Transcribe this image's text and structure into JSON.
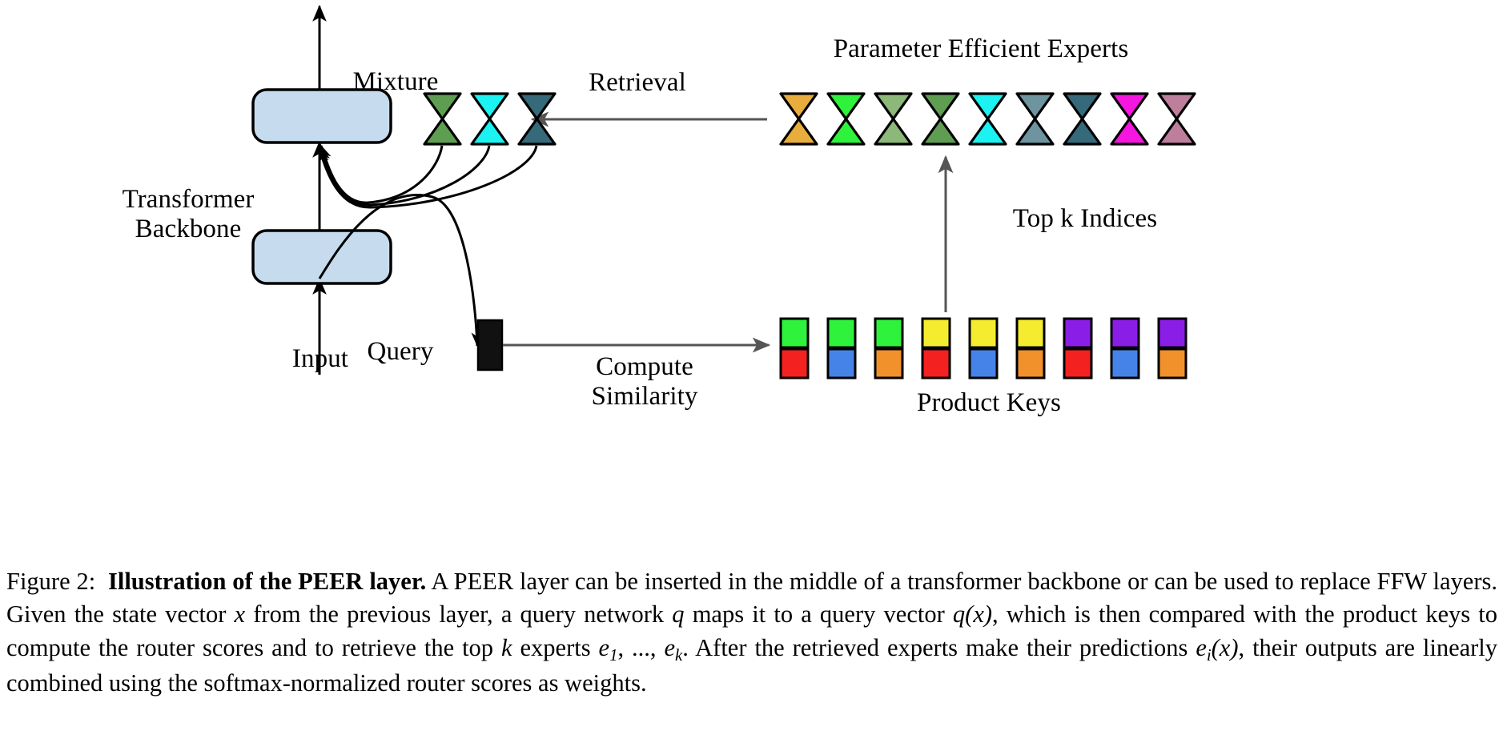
{
  "figure": {
    "labels": {
      "mixture": "Mixture",
      "transformer_backbone": "Transformer\nBackbone",
      "input": "Input",
      "query": "Query",
      "retrieval": "Retrieval",
      "parameter_efficient_experts": "Parameter Efficient Experts",
      "top_k_indices": "Top k Indices",
      "compute_similarity": "Compute\nSimilarity",
      "product_keys": "Product Keys"
    },
    "transformer_blocks": [
      {
        "name": "upper-transformer-block",
        "fill": "#c6dcee",
        "stroke": "#000000"
      },
      {
        "name": "lower-transformer-block",
        "fill": "#c6dcee",
        "stroke": "#000000"
      }
    ],
    "query_vector": {
      "fill": "#111111",
      "stroke": "#000000"
    },
    "mixture_experts": [
      {
        "index": 1,
        "fill": "#5f9e52"
      },
      {
        "index": 2,
        "fill": "#1cf2f2"
      },
      {
        "index": 3,
        "fill": "#36697a"
      }
    ],
    "experts": [
      {
        "index": 1,
        "fill": "#e8ad3c"
      },
      {
        "index": 2,
        "fill": "#2ef23c"
      },
      {
        "index": 3,
        "fill": "#8cb87a"
      },
      {
        "index": 4,
        "fill": "#5f9e52"
      },
      {
        "index": 5,
        "fill": "#1cf2f2"
      },
      {
        "index": 6,
        "fill": "#6e94a0"
      },
      {
        "index": 7,
        "fill": "#36697a"
      },
      {
        "index": 8,
        "fill": "#f715e0"
      },
      {
        "index": 9,
        "fill": "#bd7f9c"
      }
    ],
    "product_keys": {
      "top_row": [
        "#2ef23c",
        "#2ef23c",
        "#2ef23c",
        "#f5ec2f",
        "#f5ec2f",
        "#f5ec2f",
        "#8b1ee6",
        "#8b1ee6",
        "#8b1ee6"
      ],
      "bottom_row": [
        "#f42121",
        "#4583e8",
        "#f0912c",
        "#f42121",
        "#4583e8",
        "#f0912c",
        "#f42121",
        "#4583e8",
        "#f0912c"
      ]
    },
    "arrows": {
      "retrieval_direction": "right-to-left",
      "top_k_indices_direction": "upward",
      "compute_similarity_direction": "left-to-right",
      "input_direction": "upward",
      "output_direction": "upward"
    },
    "colors": {
      "block_fill": "#c6dcee",
      "stroke": "#000000",
      "arrow_gray": "#555555"
    }
  },
  "caption": {
    "prefix": "Figure 2:",
    "bold_title": "Illustration of the PEER layer.",
    "line1_rest": " A PEER layer can be inserted in the middle of a transformer",
    "line2": "backbone or can be used to replace FFW layers. Given the state vector ",
    "line2_math_x": "x",
    "line2_rest": " from the previous layer, a query",
    "line3_a": "network ",
    "line3_math_q": "q",
    "line3_b": " maps it to a query vector ",
    "line3_math_qx": "q(x)",
    "line3_c": ", which is then compared with the product keys to compute the",
    "line4_a": "router scores and to retrieve the top ",
    "line4_math_k": "k",
    "line4_b": " experts ",
    "line4_math_e1": "e",
    "line4_math_e1sub": "1",
    "line4_math_ellipsis": ", ..., ",
    "line4_math_ek": "e",
    "line4_math_eksub": "k",
    "line4_c": ". After the retrieved experts make their predictions",
    "line5_math_ei": "e",
    "line5_math_eisub": "i",
    "line5_math_eix": "(x)",
    "line5_rest": ", their outputs are linearly combined using the softmax-normalized router scores as weights."
  }
}
